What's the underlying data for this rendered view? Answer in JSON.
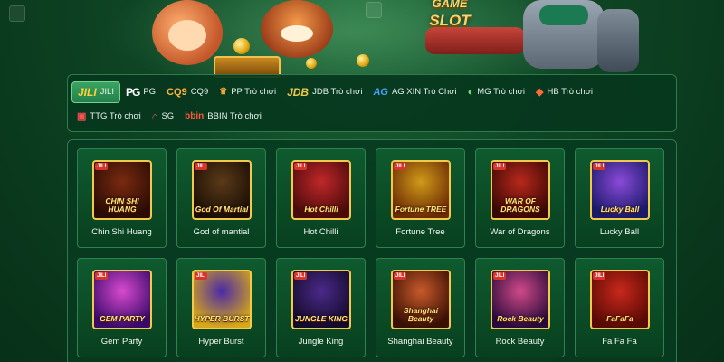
{
  "hero": {
    "title_line1": "GAME",
    "title_line2": "SLOT"
  },
  "providers": [
    {
      "logo": "JILI",
      "label": "JILI",
      "logo_class": "logo-jili",
      "active": true
    },
    {
      "logo": "PG",
      "label": "PG",
      "logo_class": "logo-pg"
    },
    {
      "logo": "CQ9",
      "label": "CQ9",
      "logo_class": "logo-cq9"
    },
    {
      "logo": "♛",
      "label": "PP Trò chơi",
      "logo_class": "logo-pp"
    },
    {
      "logo": "JDB",
      "label": "JDB Trò chơi",
      "logo_class": "logo-jdb"
    },
    {
      "logo": "AG",
      "label": "AG XIN Trò Chơi",
      "logo_class": "logo-ag"
    },
    {
      "logo": "◐",
      "label": "MG Trò chơi",
      "logo_class": "logo-mg"
    },
    {
      "logo": "◆",
      "label": "HB Trò chơi",
      "logo_class": "logo-hb"
    },
    {
      "logo": "▣",
      "label": "TTG Trò chơi",
      "logo_class": "logo-ttg"
    },
    {
      "logo": "⌂",
      "label": "SG",
      "logo_class": "logo-sg"
    },
    {
      "logo": "bbin",
      "label": "BBIN Trò chơi",
      "logo_class": "logo-bbin"
    }
  ],
  "games": [
    {
      "name": "Chin Shi Huang",
      "art": "CHIN SHI HUANG",
      "tag": "JILI",
      "colors": [
        "#7a2a10",
        "#2a0c04"
      ]
    },
    {
      "name": "God of mantial",
      "art": "God Of Martial",
      "tag": "JILI",
      "colors": [
        "#5a3a18",
        "#1a0e04"
      ]
    },
    {
      "name": "Hot Chilli",
      "art": "Hot Chilli",
      "tag": "JILI",
      "colors": [
        "#c0282a",
        "#4a0a0a"
      ]
    },
    {
      "name": "Fortune Tree",
      "art": "Fortune TREE",
      "tag": "JILI",
      "colors": [
        "#d09a18",
        "#6a2a04"
      ]
    },
    {
      "name": "War of Dragons",
      "art": "WAR OF DRAGONS",
      "tag": "JILI",
      "colors": [
        "#b8281c",
        "#3a0804"
      ]
    },
    {
      "name": "Lucky Ball",
      "art": "Lucky Ball",
      "tag": "JILI",
      "colors": [
        "#8a4ad8",
        "#1a1a6a"
      ]
    },
    {
      "name": "Gem Party",
      "art": "GEM PARTY",
      "tag": "JILI",
      "colors": [
        "#d84ad0",
        "#3a0a6a"
      ]
    },
    {
      "name": "Hyper Burst",
      "art": "HYPER BURST",
      "tag": "JILI",
      "colors": [
        "#4a2aa8",
        "#d8a818"
      ]
    },
    {
      "name": "Jungle King",
      "art": "JUNGLE KING",
      "tag": "JILI",
      "colors": [
        "#4a2a8a",
        "#140a2a"
      ]
    },
    {
      "name": "Shanghai Beauty",
      "art": "Shanghai Beauty",
      "tag": "JILI",
      "colors": [
        "#c85a2a",
        "#3a1004"
      ]
    },
    {
      "name": "Rock Beauty",
      "art": "Rock Beauty",
      "tag": "JILI",
      "colors": [
        "#d04a8a",
        "#2a0a3a"
      ]
    },
    {
      "name": "Fa Fa Fa",
      "art": "FaFaFa",
      "tag": "JILI",
      "colors": [
        "#c8281c",
        "#5a0a04"
      ]
    }
  ]
}
